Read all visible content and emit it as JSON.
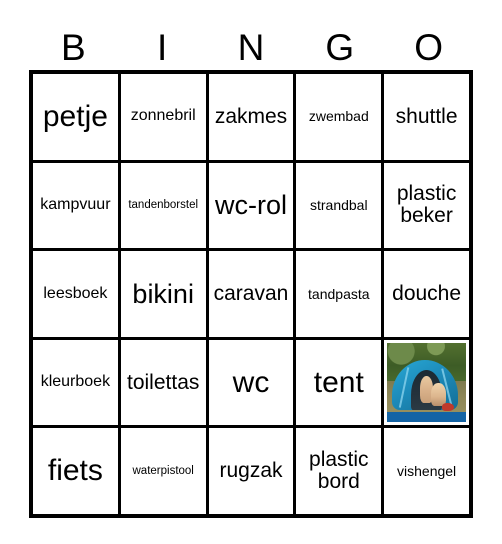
{
  "card": {
    "title": "BINGO",
    "header_letters": [
      "B",
      "I",
      "N",
      "G",
      "O"
    ],
    "columns": 5,
    "rows": 5,
    "border_color": "#000000",
    "cell_background": "#ffffff",
    "text_color": "#000000"
  },
  "cells": [
    {
      "label": "petje",
      "size": "xl",
      "type": "text"
    },
    {
      "label": "zonnebril",
      "size": "sm",
      "type": "text"
    },
    {
      "label": "zakmes",
      "size": "md",
      "type": "text"
    },
    {
      "label": "zwembad",
      "size": "xs",
      "type": "text"
    },
    {
      "label": "shuttle",
      "size": "md",
      "type": "text"
    },
    {
      "label": "kampvuur",
      "size": "sm",
      "type": "text"
    },
    {
      "label": "tandenborstel",
      "size": "xxs",
      "type": "text"
    },
    {
      "label": "wc-rol",
      "size": "lg",
      "type": "text"
    },
    {
      "label": "strandbal",
      "size": "xs",
      "type": "text"
    },
    {
      "label": "plastic beker",
      "size": "md",
      "type": "text"
    },
    {
      "label": "leesboek",
      "size": "sm",
      "type": "text"
    },
    {
      "label": "bikini",
      "size": "lg",
      "type": "text"
    },
    {
      "label": "caravan",
      "size": "md",
      "type": "text"
    },
    {
      "label": "tandpasta",
      "size": "xs",
      "type": "text"
    },
    {
      "label": "douche",
      "size": "md",
      "type": "text"
    },
    {
      "label": "kleurboek",
      "size": "sm",
      "type": "text"
    },
    {
      "label": "toilettas",
      "size": "md",
      "type": "text"
    },
    {
      "label": "wc",
      "size": "xl",
      "type": "text"
    },
    {
      "label": "tent",
      "size": "xl",
      "type": "text"
    },
    {
      "label": "tent-photo",
      "size": "md",
      "type": "image",
      "image": {
        "description": "blue dome tent in a forest with two people sitting in the opening",
        "tent_color": "#1d8cbb",
        "foliage_color": "#3d5c26",
        "ground_color": "#8e8757",
        "caption_bar_color": "#1464a5",
        "caption_left": "",
        "caption_right": ""
      }
    },
    {
      "label": "fiets",
      "size": "xl",
      "type": "text"
    },
    {
      "label": "waterpistool",
      "size": "xxs",
      "type": "text"
    },
    {
      "label": "rugzak",
      "size": "md",
      "type": "text"
    },
    {
      "label": "plastic bord",
      "size": "md",
      "type": "text"
    },
    {
      "label": "vishengel",
      "size": "xs",
      "type": "text"
    }
  ]
}
